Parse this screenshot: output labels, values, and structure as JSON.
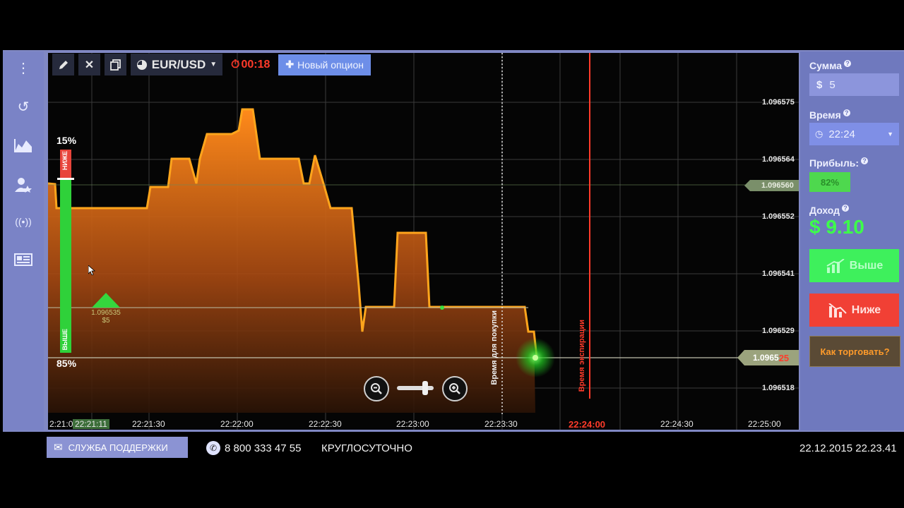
{
  "toolbar": {
    "pair": "EUR/USD",
    "timer": "00:18",
    "new_option_label": "Новый опцион"
  },
  "sidebar": {
    "icons": [
      "more-icon",
      "history-icon",
      "chart-icon",
      "users-icon",
      "signal-icon",
      "news-icon"
    ]
  },
  "chart": {
    "y_labels": [
      "1.096575",
      "1.096564",
      "1.096560",
      "1.096552",
      "1.096541",
      "1.096529",
      "1.096518"
    ],
    "current_price_tag": "1.0965",
    "current_price_tag_suffix": "25",
    "x_ticks": [
      "2:21:0",
      "22:21:11",
      "22:21:30",
      "22:22:00",
      "22:22:30",
      "22:23:00",
      "22:23:30",
      "22:24:00",
      "22:24:30",
      "22:25:00"
    ],
    "purchase_time_label": "Время для покупки",
    "expiry_time_label": "Время экспирации",
    "sentiment_top": "15%",
    "sentiment_bottom": "85%",
    "sentiment_down_label": "НИЖЕ",
    "sentiment_up_label": "ВЫШЕ",
    "entry_price": "1.096535",
    "entry_amount": "$5"
  },
  "panel": {
    "amount_label": "Сумма",
    "amount_currency": "$",
    "amount_value": "5",
    "time_label": "Время",
    "time_value": "22:24",
    "profit_label": "Прибыль:",
    "profit_value": "82%",
    "income_label": "Доход",
    "income_value": "$ 9.10",
    "up_button": "Выше",
    "down_button": "Ниже",
    "how_to_trade": "Как торговать?"
  },
  "footer": {
    "support": "СЛУЖБА ПОДДЕРЖКИ",
    "phone": "8 800 333 47 55",
    "hours": "КРУГЛОСУТОЧНО",
    "datetime": "22.12.2015 22.23.41"
  },
  "colors": {
    "accent": "#6d8ee8",
    "up": "#2ee85a",
    "down": "#ee3a33",
    "line": "#ffa51c",
    "expiry": "#ff3b2a"
  }
}
